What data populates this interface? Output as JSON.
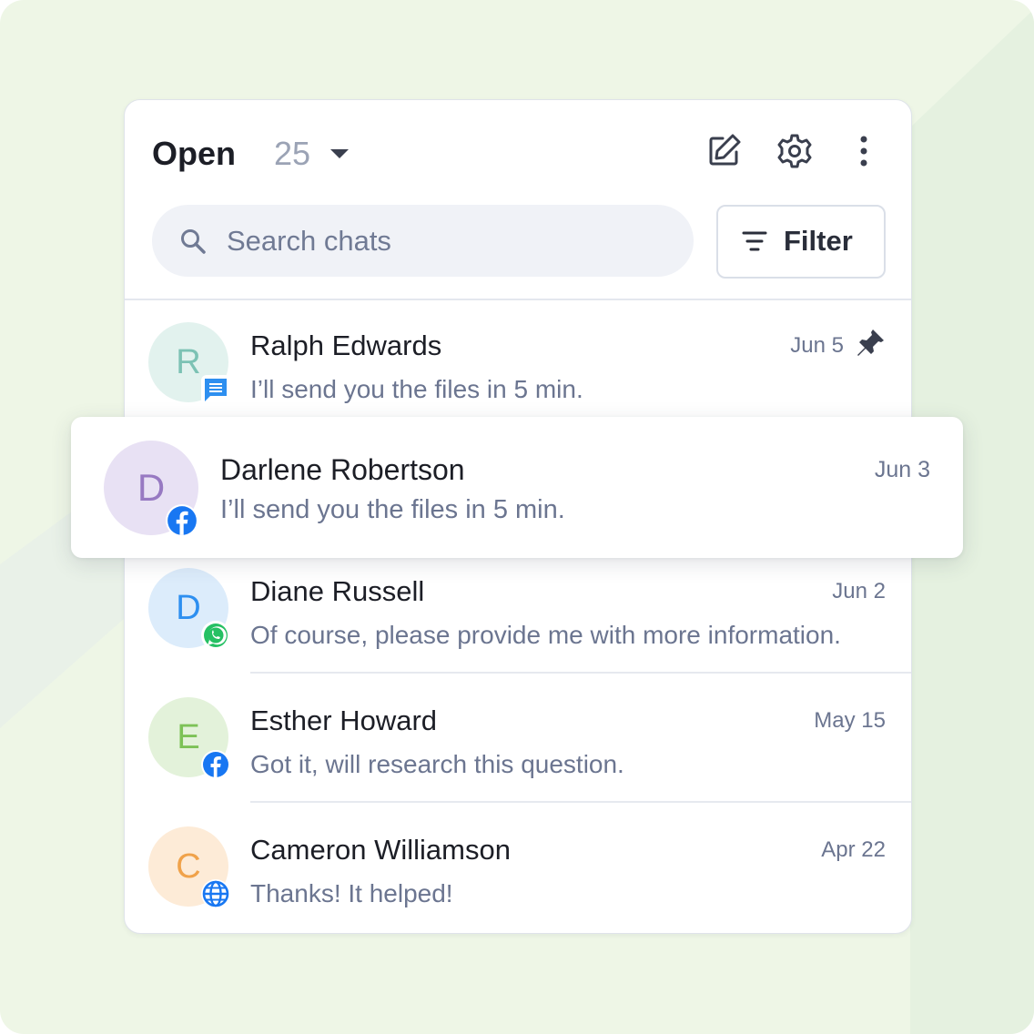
{
  "header": {
    "title": "Open",
    "count": "25"
  },
  "search": {
    "placeholder": "Search chats",
    "value": ""
  },
  "filter": {
    "label": "Filter"
  },
  "chats": [
    {
      "initial": "R",
      "name": "Ralph Edwards",
      "message": "I’ll send you the files in 5 min.",
      "date": "Jun 5",
      "channel": "chat-icon",
      "pinned": true,
      "avatar_bg": "#e2f2ee",
      "avatar_fg": "#7cc2b4"
    },
    {
      "initial": "D",
      "name": "Darlene Robertson",
      "message": "I’ll send you the files in 5 min.",
      "date": "Jun 3",
      "channel": "facebook-icon",
      "avatar_bg": "#e8e1f4",
      "avatar_fg": "#9779c2"
    },
    {
      "initial": "D",
      "name": "Diane Russell",
      "message": "Of course, please provide me with more information.",
      "date": "Jun 2",
      "channel": "whatsapp-icon",
      "avatar_bg": "#dcecfb",
      "avatar_fg": "#2d8ff0"
    },
    {
      "initial": "E",
      "name": "Esther Howard",
      "message": "Got it, will research this question.",
      "date": "May 15",
      "channel": "facebook-icon",
      "avatar_bg": "#e3f2da",
      "avatar_fg": "#7dc257"
    },
    {
      "initial": "C",
      "name": "Cameron Williamson",
      "message": "Thanks! It helped!",
      "date": "Apr 22",
      "channel": "globe-icon",
      "avatar_bg": "#fdebd7",
      "avatar_fg": "#f0a24a"
    }
  ],
  "colors": {
    "background": "#eef6e6",
    "facebook": "#1877f2",
    "whatsapp": "#25c063",
    "chat_badge": "#2d8ff0"
  }
}
